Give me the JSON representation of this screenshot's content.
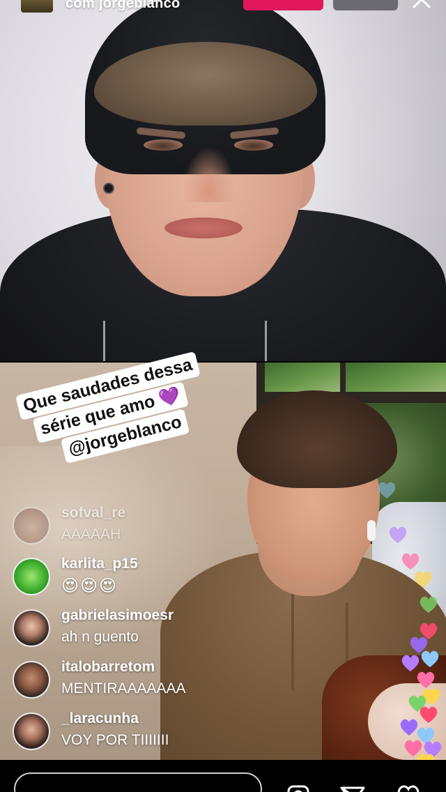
{
  "header": {
    "username": "com jorgeblanco"
  },
  "sticker": {
    "line1": "Que saudades dessa",
    "line2": "série que amo 💜",
    "line3": "@jorgeblanco"
  },
  "comments": [
    {
      "username": "sofval_re",
      "text": "AAAAAH"
    },
    {
      "username": "karlita_p15",
      "text": "😍😍😍"
    },
    {
      "username": "gabrielasimoesr",
      "text": "ah n guento"
    },
    {
      "username": "italobarretom",
      "text": "MENTIRAAAAAAA"
    },
    {
      "username": "_laracunha",
      "text": "VOY POR TIIIIIII"
    }
  ],
  "icons": {
    "close": "close-icon",
    "comment_box": "comment-input",
    "camera": "camera-icon",
    "share": "paper-plane-icon",
    "like": "heart-icon"
  },
  "colors": {
    "accent_pink": "#e2185c",
    "sticker_bg": "#ffffff",
    "heart_colors": [
      "#8ec8ff",
      "#b57cff",
      "#ff6fa5",
      "#ffd54a",
      "#7ad36a",
      "#ff4b6e",
      "#9b6bff"
    ]
  }
}
